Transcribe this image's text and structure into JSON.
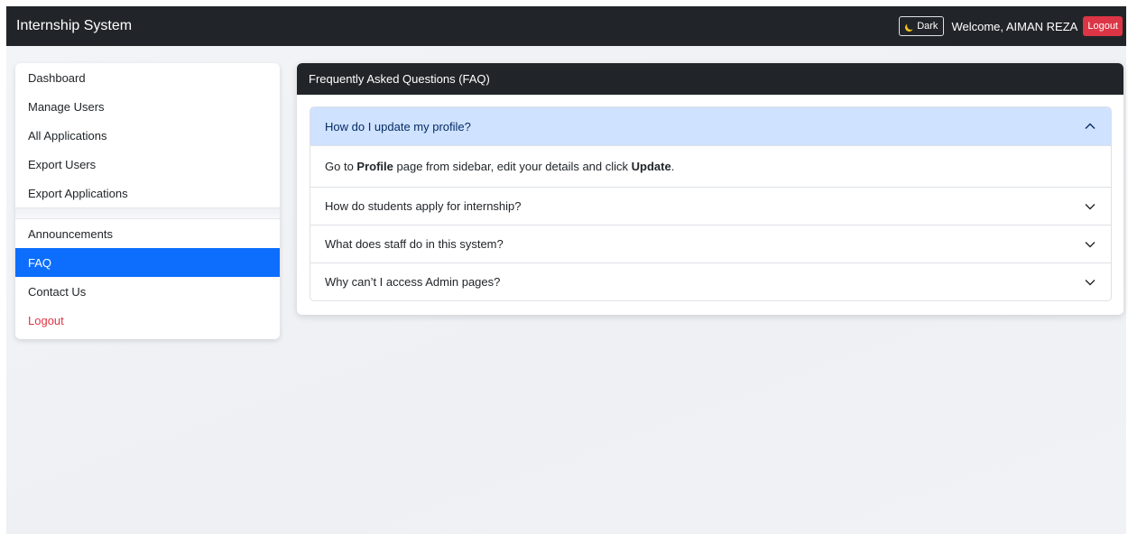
{
  "navbar": {
    "brand": "Internship System",
    "theme_label": "Dark",
    "theme_icon": "moon-icon",
    "welcome": "Welcome, AIMAN REZA",
    "logout_label": "Logout"
  },
  "sidebar": {
    "group1": [
      {
        "label": "Dashboard"
      },
      {
        "label": "Manage Users"
      },
      {
        "label": "All Applications"
      },
      {
        "label": "Export Users"
      },
      {
        "label": "Export Applications"
      }
    ],
    "group2": [
      {
        "label": "Announcements"
      },
      {
        "label": "FAQ",
        "active": true
      },
      {
        "label": "Contact Us"
      },
      {
        "label": "Logout"
      }
    ]
  },
  "faq": {
    "title": "Frequently Asked Questions (FAQ)",
    "items": [
      {
        "question": "How do I update my profile?",
        "expanded": true,
        "answer": {
          "t1": "Go to ",
          "b1": "Profile",
          "t2": " page from sidebar, edit your details and click ",
          "b2": "Update",
          "t3": "."
        }
      },
      {
        "question": "How do students apply for internship?",
        "expanded": false
      },
      {
        "question": "What does staff do in this system?",
        "expanded": false
      },
      {
        "question": "Why can’t I access Admin pages?",
        "expanded": false
      }
    ]
  },
  "colors": {
    "navbar_bg": "#212529",
    "primary": "#0d6efd",
    "danger": "#dc3545",
    "accordion_open_bg": "#cfe2ff"
  }
}
